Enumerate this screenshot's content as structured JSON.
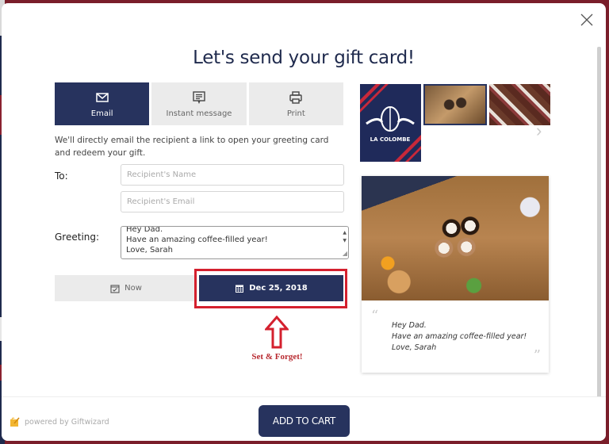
{
  "modal": {
    "title": "Let's send your gift card!",
    "close_icon": "close-icon"
  },
  "delivery_tabs": [
    {
      "label": "Email",
      "icon": "envelope-icon",
      "active": true
    },
    {
      "label": "Instant message",
      "icon": "message-icon",
      "active": false
    },
    {
      "label": "Print",
      "icon": "printer-icon",
      "active": false
    }
  ],
  "description": "We'll directly email the recipient a link to open your greeting card and redeem your gift.",
  "form": {
    "to_label": "To:",
    "recipient_name_placeholder": "Recipient's Name",
    "recipient_email_placeholder": "Recipient's Email",
    "greeting_label": "Greeting:",
    "greeting_lines": [
      "Hey Dad.",
      "Have an amazing coffee-filled year!",
      "Love, Sarah"
    ]
  },
  "delivery_time": {
    "now_label": "Now",
    "date_label": "Dec 25, 2018",
    "selected": "date"
  },
  "annotation": {
    "text": "Set & Forget!",
    "color": "#d4202e"
  },
  "card_designs": {
    "thumbnails": [
      "La Colombe logo design",
      "Coffee toast photo",
      "Coffee products photo"
    ],
    "selected_index": 1,
    "brand_text": "LA COLOMBE"
  },
  "preview": {
    "message_lines": [
      "Hey Dad.",
      "Have an amazing coffee-filled year!",
      "Love, Sarah"
    ]
  },
  "footer": {
    "powered_by": "powered by Giftwizard",
    "add_to_cart": "ADD TO CART"
  },
  "colors": {
    "primary": "#27335e",
    "inactive_tab": "#ebebeb",
    "highlight": "#d4202e"
  }
}
